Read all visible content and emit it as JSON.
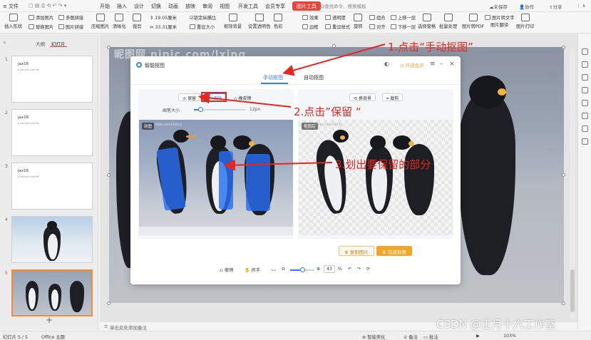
{
  "menubar": {
    "file": "文件",
    "items": [
      "开始",
      "插入",
      "设计",
      "切换",
      "动画",
      "放映",
      "审阅",
      "视图",
      "开发工具",
      "会员专享"
    ],
    "active_tab": "图片工具",
    "search_placeholder": "Q查找命令、搜索模板",
    "unsaved": "未保存",
    "collab": "协作",
    "share": "分享"
  },
  "ribbon": {
    "row1": [
      "添加图片",
      "多图拼接",
      "图片拼接",
      "压缩图片",
      "清晰化",
      "裁剪",
      "19.05厘米",
      "锁定纵横比",
      "抠除背景",
      "设置透明色",
      "色彩",
      "效果",
      "透明度",
      "组合",
      "上移一层",
      "旋转",
      "批量处理",
      "图片转文字",
      "图片转PDF",
      "图片翻译",
      "图片打印"
    ],
    "row2": [
      "插入形状",
      "替换图片",
      "33.31厘米",
      "重设大小",
      "边框",
      "重设样式",
      "对齐",
      "下移一层",
      "选择窗格"
    ]
  },
  "leftpanel": {
    "tabs": [
      "大纲",
      "幻灯片"
    ],
    "slides": [
      {
        "num": "1",
        "title": "jax16",
        "sub": "a sample subtitle"
      },
      {
        "num": "2",
        "title": "jax16",
        "sub": "a sample subtitle"
      },
      {
        "num": "3",
        "title": "jax16",
        "sub": "a sample subtitle"
      },
      {
        "num": "4",
        "title": "",
        "sub": ""
      },
      {
        "num": "5",
        "title": "",
        "sub": ""
      }
    ],
    "add": "+"
  },
  "slide": {
    "watermark": "昵图网 nipic.com/lxing"
  },
  "dialog": {
    "title": "智能抠图",
    "vip": "开通会员",
    "tabs": [
      "手动抠图",
      "自动抠图"
    ],
    "keep": "保留",
    "erase": "去除",
    "brush_eraser": "橡皮擦",
    "brush_size_label": "画笔大小",
    "brush_size_value": "12px",
    "change_bg": "换背景",
    "crop": "裁剪",
    "original_tag": "原图",
    "result_tag": "抠图后",
    "img_watermark": "nipic.com/lxing",
    "copy_btn": "复制图片",
    "done_btn": "完成抠图",
    "bottom": {
      "undo": "撤销",
      "grab": "抓手",
      "zoom": "43",
      "pct": "%"
    }
  },
  "annotations": {
    "step1": "1.点击“手动抠图”",
    "step2": "2.点击”保留 “",
    "step3": "3.划出要保留的部分"
  },
  "notes": "单击此处添加备注",
  "status": {
    "slide_info": "幻灯片 5 / 5",
    "theme": "Office 主题",
    "smart": "智能美化",
    "notes": "备注",
    "comments": "批注",
    "zoom": "103%"
  },
  "csdn": "CSDN @正月十六工作室"
}
